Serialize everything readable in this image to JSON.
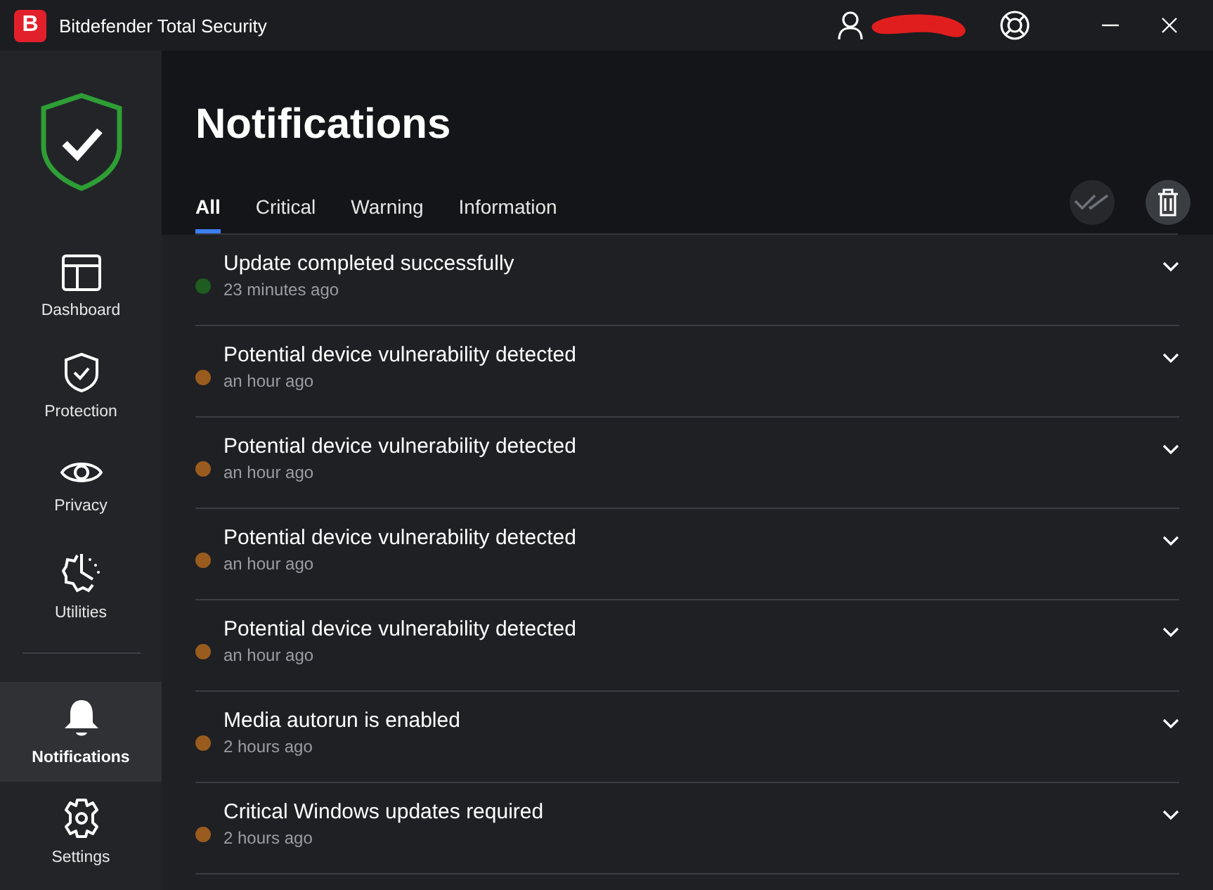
{
  "window": {
    "title": "Bitdefender Total Security",
    "logo": "B"
  },
  "sidebar": {
    "items": [
      {
        "label": "Dashboard",
        "kind": "dashboard",
        "selected": false
      },
      {
        "label": "Protection",
        "kind": "protection",
        "selected": false
      },
      {
        "label": "Privacy",
        "kind": "privacy",
        "selected": false
      },
      {
        "label": "Utilities",
        "kind": "utilities",
        "selected": false
      }
    ],
    "bottom_items": [
      {
        "label": "Notifications",
        "kind": "notifications",
        "selected": true
      },
      {
        "label": "Settings",
        "kind": "settings",
        "selected": false
      }
    ]
  },
  "page": {
    "title": "Notifications"
  },
  "tabs": [
    {
      "label": "All",
      "selected": true
    },
    {
      "label": "Critical",
      "selected": false
    },
    {
      "label": "Warning",
      "selected": false
    },
    {
      "label": "Information",
      "selected": false
    }
  ],
  "notifications": [
    {
      "title": "Update completed successfully",
      "time": "23 minutes ago",
      "color": "#1f5c1f"
    },
    {
      "title": "Potential device vulnerability detected",
      "time": "an hour ago",
      "color": "#9a5c1e"
    },
    {
      "title": "Potential device vulnerability detected",
      "time": "an hour ago",
      "color": "#9a5c1e"
    },
    {
      "title": "Potential device vulnerability detected",
      "time": "an hour ago",
      "color": "#9a5c1e"
    },
    {
      "title": "Potential device vulnerability detected",
      "time": "an hour ago",
      "color": "#9a5c1e"
    },
    {
      "title": "Media autorun is enabled",
      "time": "2 hours ago",
      "color": "#9a5c1e"
    },
    {
      "title": "Critical Windows updates required",
      "time": "2 hours ago",
      "color": "#9a5c1e"
    }
  ]
}
